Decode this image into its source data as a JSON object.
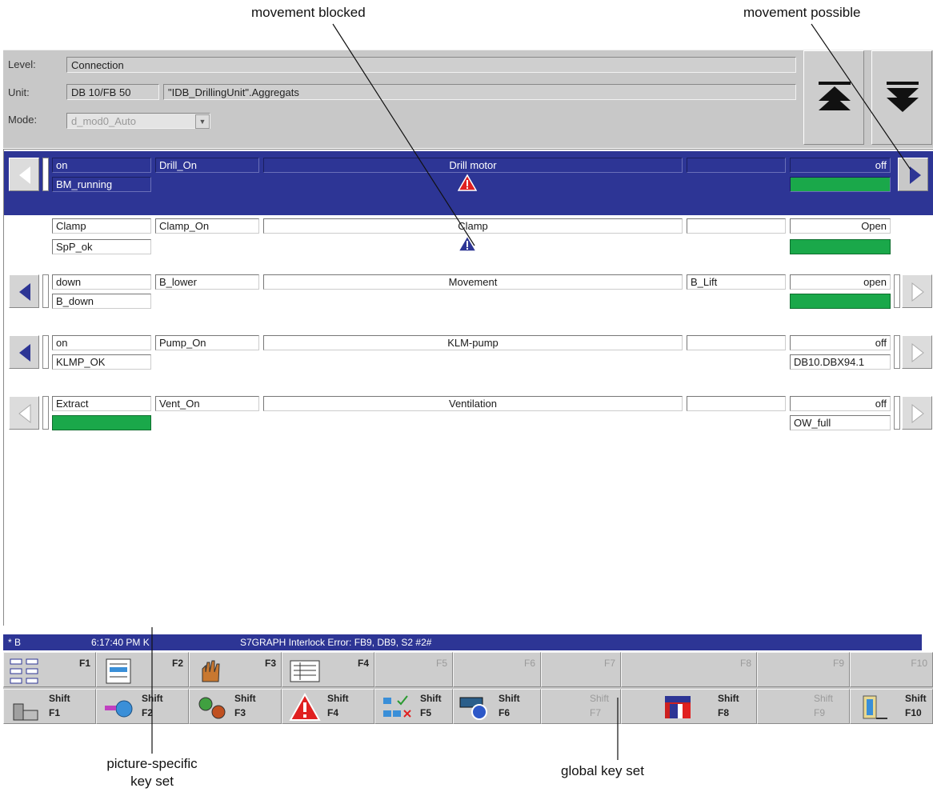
{
  "callouts": {
    "movement_blocked": "movement blocked",
    "movement_possible": "movement possible",
    "picture_specific_1": "picture-specific",
    "picture_specific_2": "key set",
    "global_key_set": "global key set"
  },
  "header": {
    "level_label": "Level:",
    "level_value": "Connection",
    "unit_label": "Unit:",
    "unit_db": "DB 10/FB 50",
    "unit_name": "\"IDB_DrillingUnit\".Aggregats",
    "mode_label": "Mode:",
    "mode_value": "d_mod0_Auto"
  },
  "rows": [
    {
      "c1": "on",
      "c2": "Drill_On",
      "c3": "Drill motor",
      "c4": "",
      "c5": "off",
      "d1": "BM_running",
      "d5": "",
      "status_icon": "warning-red-icon",
      "selected": true
    },
    {
      "c1": "Clamp",
      "c2": "Clamp_On",
      "c3": "Clamp",
      "c4": "",
      "c5": "Open",
      "d1": "SpP_ok",
      "d5": "",
      "status_icon": "warning-blue-icon",
      "selected": false
    },
    {
      "c1": "down",
      "c2": "B_lower",
      "c3": "Movement",
      "c4": "B_Lift",
      "c5": "open",
      "d1": "B_down",
      "d5": ""
    },
    {
      "c1": "on",
      "c2": "Pump_On",
      "c3": "KLM-pump",
      "c4": "",
      "c5": "off",
      "d1": "KLMP_OK",
      "d5": "DB10.DBX94.1"
    },
    {
      "c1": "Extract",
      "c2": "Vent_On",
      "c3": "Ventilation",
      "c4": "",
      "c5": "off",
      "d1": "",
      "d5": "OW_full"
    }
  ],
  "status_bar": {
    "flag": "* B",
    "time": "6:17:40 PM K",
    "message": "S7GRAPH Interlock Error: FB9, DB9, S2  #2#"
  },
  "keys_row1": [
    "F1",
    "F2",
    "F3",
    "F4",
    "F5",
    "F6",
    "F7",
    "F8",
    "F9",
    "F10"
  ],
  "keys_row2": [
    {
      "s": "Shift",
      "k": "F1"
    },
    {
      "s": "Shift",
      "k": "F2"
    },
    {
      "s": "Shift",
      "k": "F3"
    },
    {
      "s": "Shift",
      "k": "F4"
    },
    {
      "s": "Shift",
      "k": "F5"
    },
    {
      "s": "Shift",
      "k": "F6"
    },
    {
      "s": "Shift",
      "k": "F7"
    },
    {
      "s": "Shift",
      "k": "F8"
    },
    {
      "s": "Shift",
      "k": "F9"
    },
    {
      "s": "Shift",
      "k": "F10"
    }
  ],
  "colors": {
    "selected_row": "#2d3595",
    "ok_green": "#1aa84a",
    "alarm_red": "#e02020"
  }
}
